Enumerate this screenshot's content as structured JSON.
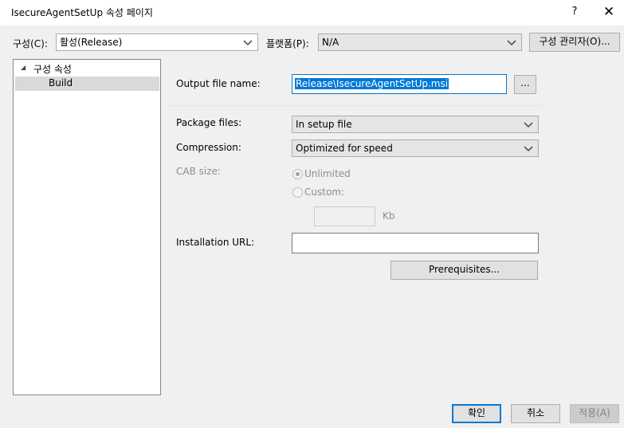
{
  "window": {
    "title": "IsecureAgentSetUp 속성 페이지",
    "help_glyph": "?",
    "close_glyph": "✕"
  },
  "toolbar": {
    "config_label": "구성(C):",
    "config_value": "활성(Release)",
    "platform_label": "플랫폼(P):",
    "platform_value": "N/A",
    "config_manager_label": "구성 관리자(O)..."
  },
  "tree": {
    "root_expander": "◢",
    "root_label": "구성 속성",
    "child_label": "Build"
  },
  "build": {
    "output_file_label": "Output file name:",
    "output_file_value": "Release\\IsecureAgentSetUp.msi",
    "browse_label": "...",
    "package_files_label": "Package files:",
    "package_files_value": "In setup file",
    "compression_label": "Compression:",
    "compression_value": "Optimized for speed",
    "cab_size_label": "CAB size:",
    "unlimited_label": "Unlimited",
    "custom_label": "Custom:",
    "custom_value": "",
    "kb_label": "Kb",
    "installation_url_label": "Installation URL:",
    "installation_url_value": "",
    "prerequisites_label": "Prerequisites..."
  },
  "footer": {
    "ok_label": "확인",
    "cancel_label": "취소",
    "apply_label": "적용(A)"
  }
}
